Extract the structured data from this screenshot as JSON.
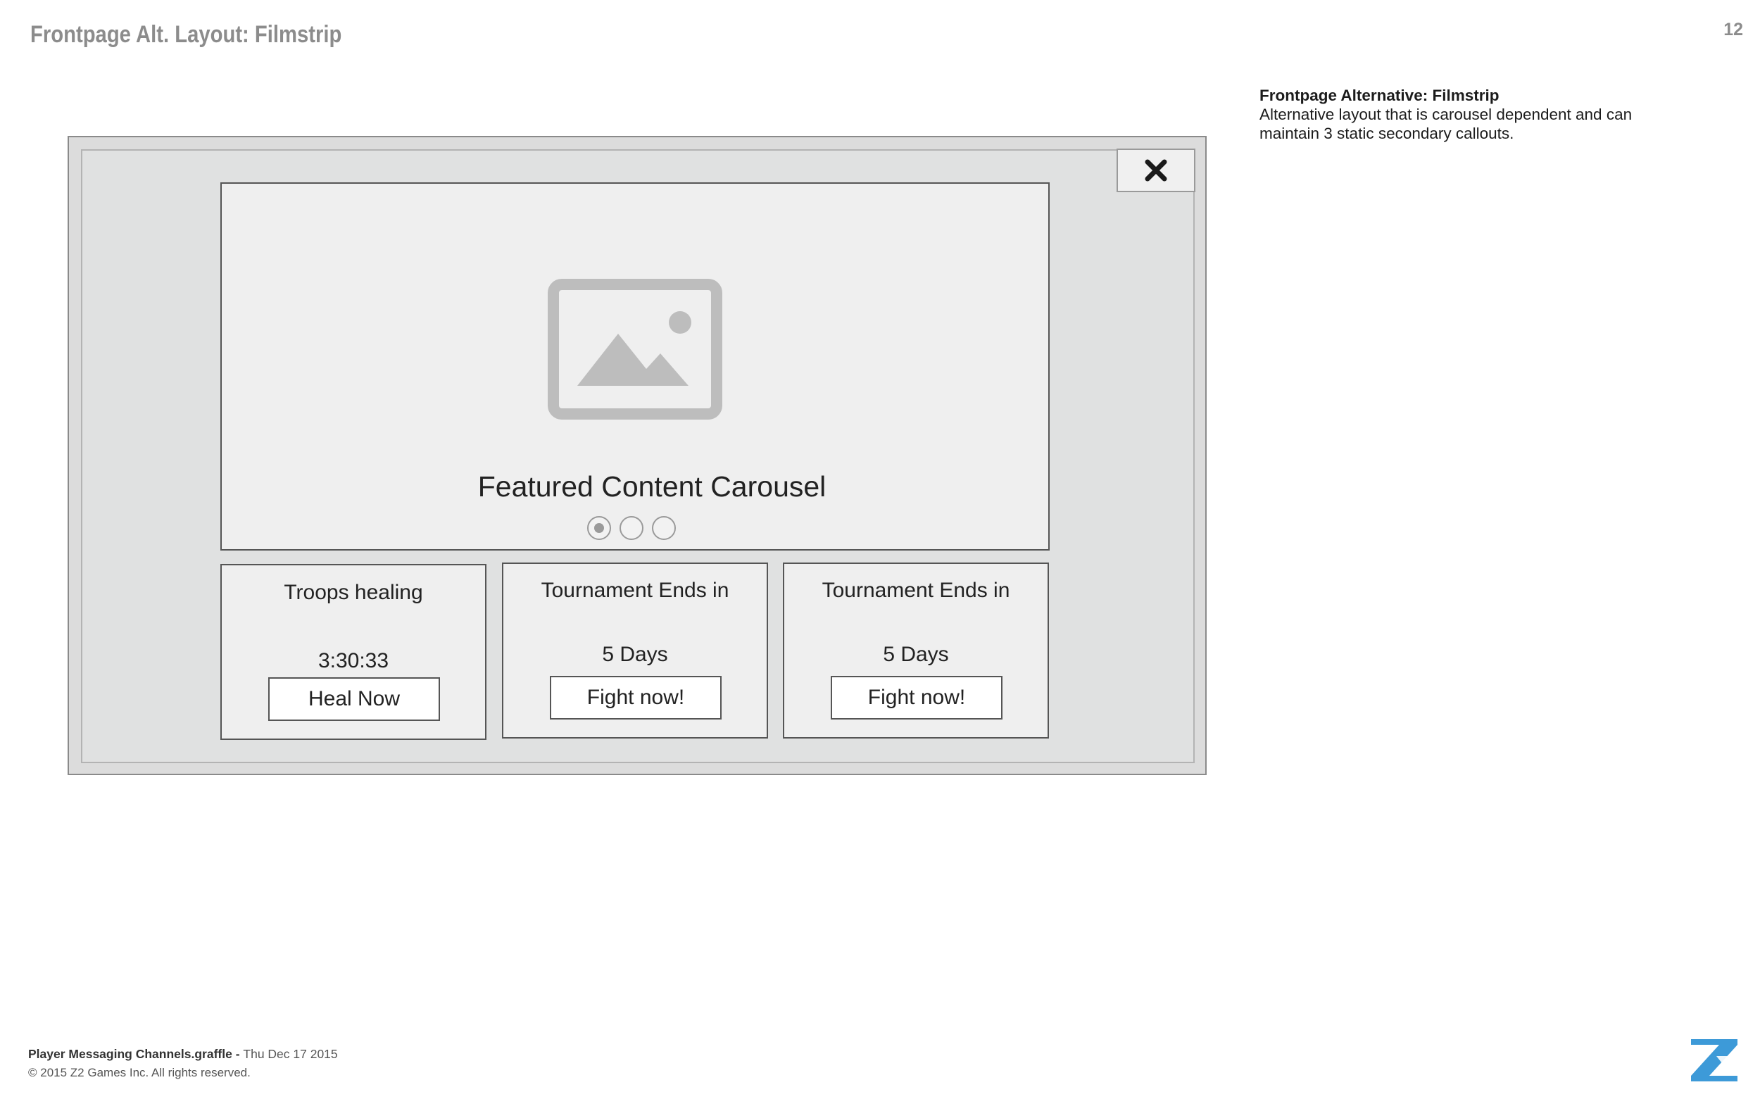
{
  "page": {
    "title": "Frontpage Alt. Layout: Filmstrip",
    "number": "12"
  },
  "notes": {
    "title": "Frontpage Alternative: Filmstrip",
    "body": "Alternative layout that is carousel dependent and can maintain 3 static secondary callouts."
  },
  "mockup": {
    "close_icon": "close-x-icon",
    "carousel": {
      "image_icon": "image-placeholder-icon",
      "label": "Featured Content Carousel",
      "pages": 3,
      "active_page": 1
    },
    "cards": [
      {
        "title": "Troops healing",
        "value": "3:30:33",
        "button": "Heal Now"
      },
      {
        "title": "Tournament Ends in",
        "value": "5 Days",
        "button": "Fight now!"
      },
      {
        "title": "Tournament Ends in",
        "value": "5 Days",
        "button": "Fight now!"
      }
    ]
  },
  "footer": {
    "filename": "Player Messaging Channels.graffle",
    "separator": " - ",
    "date": "Thu Dec 17 2015",
    "copyright": "© 2015 Z2 Games Inc. All rights reserved.",
    "logo_icon": "z2-logo-icon"
  },
  "colors": {
    "title_gray": "#8c8c8c",
    "frame_bg": "#e0e1e1",
    "panel_bg": "#efefef",
    "icon_gray": "#bdbdbd",
    "logo_blue": "#3d9ad8"
  }
}
